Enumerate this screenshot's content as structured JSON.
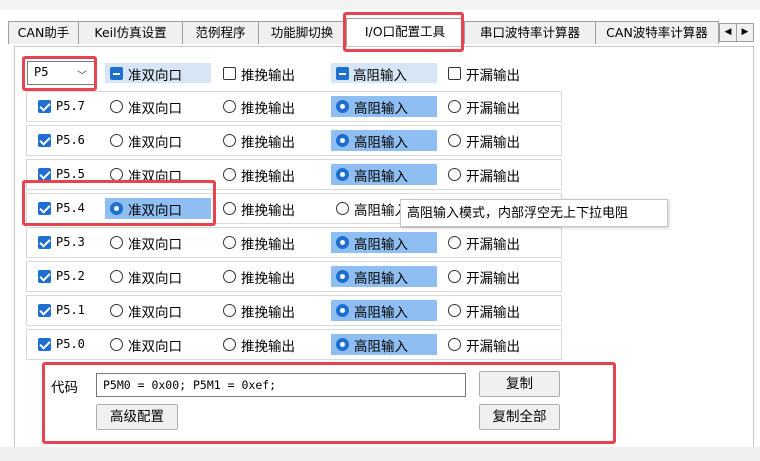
{
  "tabs": [
    {
      "label": "CAN助手",
      "active": false
    },
    {
      "label": "Keil仿真设置",
      "active": false
    },
    {
      "label": "范例程序",
      "active": false
    },
    {
      "label": "功能脚切换",
      "active": false
    },
    {
      "label": "I/O口配置工具",
      "active": true
    },
    {
      "label": "串口波特率计算器",
      "active": false
    },
    {
      "label": "CAN波特率计算器",
      "active": false
    }
  ],
  "tab_scroll": {
    "left": "◀",
    "right": "▶"
  },
  "port_select": {
    "value": "P5"
  },
  "header_options": [
    "准双向口",
    "推挽输出",
    "高阻输入",
    "开漏输出"
  ],
  "header_state": [
    "indeterminate",
    "unchecked",
    "indeterminate",
    "unchecked"
  ],
  "options": [
    "准双向口",
    "推挽输出",
    "高阻输入",
    "开漏输出"
  ],
  "pins": [
    {
      "label": "P5.7",
      "checked": true,
      "mode": 2
    },
    {
      "label": "P5.6",
      "checked": true,
      "mode": 2
    },
    {
      "label": "P5.5",
      "checked": true,
      "mode": 2
    },
    {
      "label": "P5.4",
      "checked": true,
      "mode": 0
    },
    {
      "label": "P5.3",
      "checked": true,
      "mode": 2
    },
    {
      "label": "P5.2",
      "checked": true,
      "mode": 2
    },
    {
      "label": "P5.1",
      "checked": true,
      "mode": 2
    },
    {
      "label": "P5.0",
      "checked": true,
      "mode": 2
    }
  ],
  "tooltip": "高阻输入模式，内部浮空无上下拉电阻",
  "code": {
    "label": "代码",
    "value": "P5M0 = 0x00; P5M1 = 0xef;"
  },
  "buttons": {
    "copy": "复制",
    "advanced": "高级配置",
    "copy_all": "复制全部"
  },
  "colors": {
    "accent": "#1e6fd0",
    "highlight": "#8fbef2",
    "annotation": "#e8444f"
  }
}
